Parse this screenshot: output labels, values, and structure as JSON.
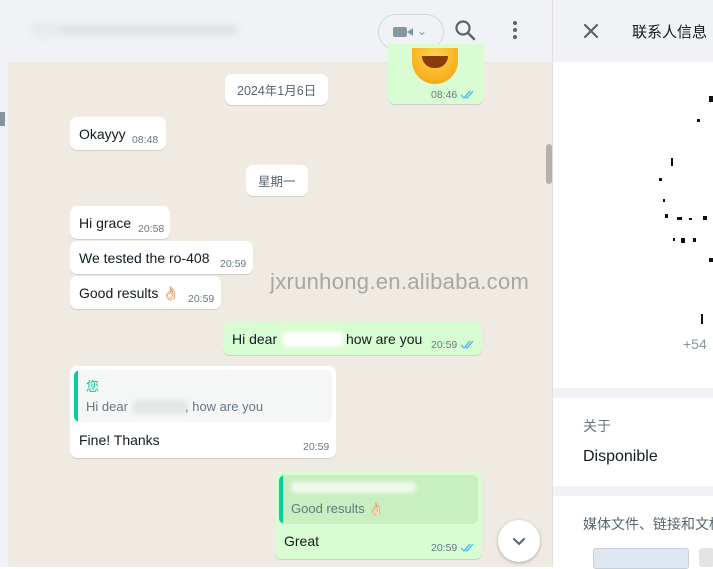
{
  "header": {
    "video_dropdown_chevron": "⌄"
  },
  "messages": {
    "prev_time": "08:46",
    "date_sep_1": "2024年1月6日",
    "okayyy": {
      "text": "Okayyy",
      "time": "08:48"
    },
    "date_sep_2": "星期一",
    "hi_grace": {
      "text": "Hi grace",
      "time": "20:58"
    },
    "tested": {
      "text": "We tested the ro-408",
      "time": "20:59"
    },
    "good_results": {
      "text": "Good results 👌🏻",
      "time": "20:59"
    },
    "hi_dear": {
      "text_a": "Hi dear",
      "text_b": "how are you",
      "time": "20:59"
    },
    "reply_fine": {
      "quote_author": "您",
      "quote_a": "Hi dear",
      "quote_b": ", how are you",
      "text": "Fine! Thanks",
      "time": "20:59"
    },
    "reply_great": {
      "quote_text": "Good results 👌🏻",
      "text": "Great",
      "time": "20:59"
    }
  },
  "watermark": "jxrunhong.en.alibaba.com",
  "contact_panel": {
    "title": "联系人信息",
    "phone_partial": "+54",
    "about_label": "关于",
    "about_value": "Disponible",
    "media_label": "媒体文件、链接和文档"
  },
  "icons": {
    "header": [
      "video-call-icon",
      "search-icon",
      "menu-icon"
    ],
    "panel": [
      "close-icon"
    ],
    "chat": [
      "read-receipt-icon",
      "chevron-down-icon"
    ]
  },
  "colors": {
    "chat_background": "#efeae2",
    "incoming_bubble": "#ffffff",
    "outgoing_bubble": "#d9fdd3",
    "read_receipt": "#53bdeb",
    "quote_accent": "#06cf9c",
    "panel_background": "#f0f2f5"
  }
}
